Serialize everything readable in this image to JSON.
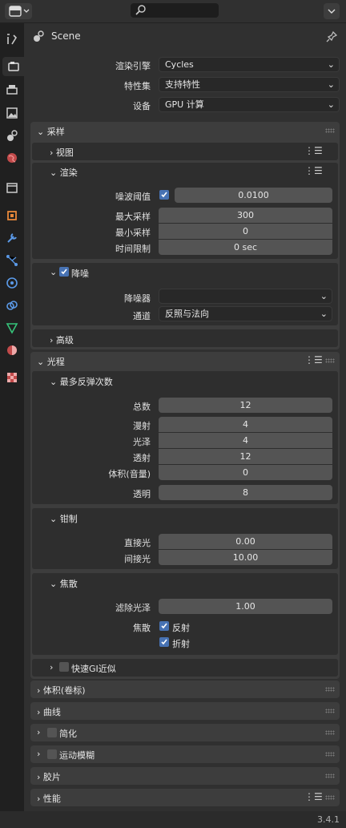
{
  "header": {
    "title": "Scene",
    "version": "3.4.1"
  },
  "render": {
    "engine_label": "渲染引擎",
    "engine_value": "Cycles",
    "feature_label": "特性集",
    "feature_value": "支持特性",
    "device_label": "设备",
    "device_value": "GPU 计算"
  },
  "sampling": {
    "title": "采样",
    "viewport": "视图",
    "render": "渲染",
    "noise_threshold_label": "噪波阈值",
    "noise_threshold_value": "0.0100",
    "max_samples_label": "最大采样",
    "max_samples_value": "300",
    "min_samples_label": "最小采样",
    "min_samples_value": "0",
    "time_limit_label": "时间限制",
    "time_limit_value": "0 sec",
    "denoise": "降噪",
    "denoiser_label": "降噪器",
    "denoiser_value": "",
    "passes_label": "通道",
    "passes_value": "反照与法向",
    "advanced": "高级"
  },
  "light_paths": {
    "title": "光程",
    "max_bounces": "最多反弹次数",
    "total_label": "总数",
    "total_value": "12",
    "diffuse_label": "漫射",
    "diffuse_value": "4",
    "glossy_label": "光泽",
    "glossy_value": "4",
    "transmission_label": "透射",
    "transmission_value": "12",
    "volume_label": "体积(音量)",
    "volume_value": "0",
    "transparent_label": "透明",
    "transparent_value": "8",
    "clamping": "钳制",
    "direct_label": "直接光",
    "direct_value": "0.00",
    "indirect_label": "间接光",
    "indirect_value": "10.00",
    "caustics": "焦散",
    "filter_glossy_label": "滤除光泽",
    "filter_glossy_value": "1.00",
    "caustics_label": "焦散",
    "reflective": "反射",
    "refractive": "折射",
    "fast_gi": "快速GI近似"
  },
  "panels": {
    "volumes": "体积(卷标)",
    "curves": "曲线",
    "simplify": "简化",
    "motion_blur": "运动模糊",
    "film": "胶片",
    "performance": "性能"
  },
  "colors": {
    "accent": "#4772b3",
    "panel": "#3d3d3d",
    "field": "#545454"
  }
}
